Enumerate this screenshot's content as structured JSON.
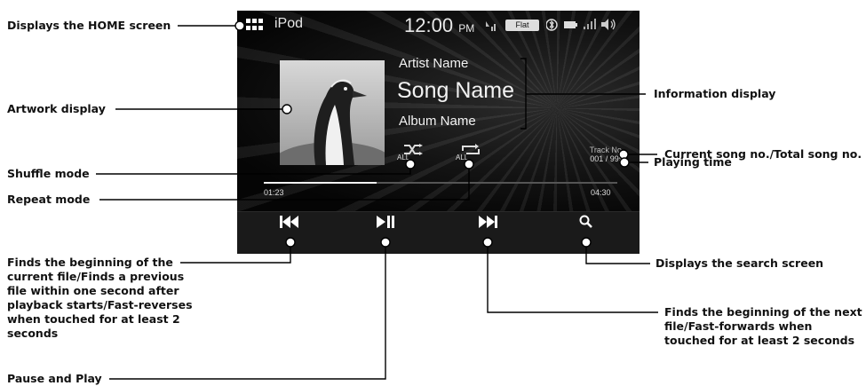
{
  "status_bar": {
    "source": "iPod",
    "time": "12:00",
    "ampm": "PM",
    "eq_badge": "Flat"
  },
  "track": {
    "artist": "Artist Name",
    "song": "Song Name",
    "album": "Album Name",
    "track_no_label": "Track No.",
    "track_no": "001 / 999",
    "elapsed": "01:23",
    "total": "04:30",
    "progress": 0.32,
    "shuffle_label": "ALL",
    "repeat_label": "ALL"
  },
  "callouts": {
    "home": "Displays the HOME screen",
    "artwork": "Artwork display",
    "shuffle": "Shuffle mode",
    "repeat": "Repeat mode",
    "prev": "Finds the beginning of the current file/Finds a previous file within one second after playback starts/Fast-reverses when touched for at least 2 seconds",
    "pause_play": "Pause and Play",
    "info": "Information display",
    "track_no": "Current song no./Total song no.",
    "playing_time": "Playing time",
    "search": "Displays the search screen",
    "next": "Finds the beginning of the next file/Fast-forwards when touched for at least 2 seconds"
  },
  "icons": {
    "home": "grid-icon",
    "prev": "skip-previous-icon",
    "play_pause": "play-pause-icon",
    "next": "skip-next-icon",
    "search": "search-icon",
    "shuffle": "shuffle-icon",
    "repeat": "repeat-icon"
  }
}
